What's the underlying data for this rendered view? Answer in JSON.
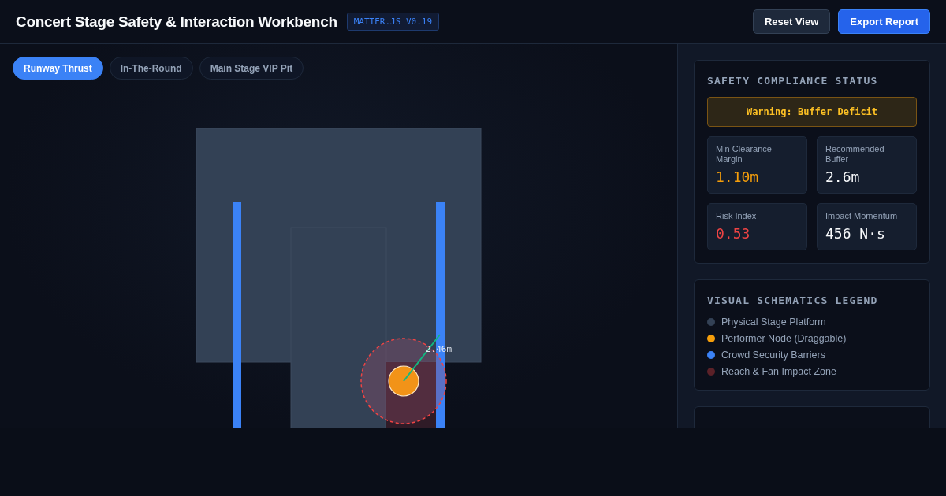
{
  "header": {
    "title": "Concert Stage Safety & Interaction Workbench",
    "badge": "MATTER.JS V0.19",
    "buttons": [
      {
        "label": "Reset View",
        "kind": "secondary"
      },
      {
        "label": "Export Report",
        "kind": "primary"
      }
    ]
  },
  "presets": [
    {
      "label": "Runway Thrust",
      "selected": true
    },
    {
      "label": "In-The-Round",
      "selected": false
    },
    {
      "label": "Main Stage VIP Pit",
      "selected": false
    }
  ],
  "canvas": {
    "distance_label": "2.46m"
  },
  "compliance": {
    "title": "SAFETY COMPLIANCE STATUS",
    "warning": "Warning: Buffer Deficit",
    "metrics": [
      {
        "label": "Min Clearance Margin",
        "value": "1.10m",
        "color": "#f59e0b"
      },
      {
        "label": "Recommended Buffer",
        "value": "2.6m",
        "color": "#f8fafc"
      },
      {
        "label": "Risk Index",
        "value": "0.53",
        "color": "#ef4444"
      },
      {
        "label": "Impact Momentum",
        "value": "456 N·s",
        "color": "#f8fafc"
      }
    ]
  },
  "legend": {
    "title": "VISUAL SCHEMATICS LEGEND",
    "items": [
      {
        "label": "Physical Stage Platform",
        "color": "#334155"
      },
      {
        "label": "Performer Node (Draggable)",
        "color": "#f59e0b"
      },
      {
        "label": "Crowd Security Barriers",
        "color": "#3b82f6"
      },
      {
        "label": "Reach & Fan Impact Zone",
        "color": "#5b2128"
      }
    ]
  }
}
